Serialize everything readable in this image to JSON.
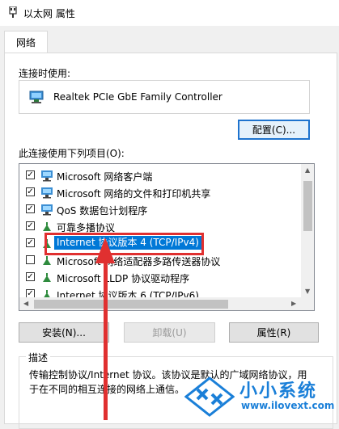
{
  "window": {
    "title": "以太网 属性"
  },
  "tabs": [
    {
      "label": "网络"
    }
  ],
  "connect_using": {
    "label": "连接时使用:",
    "adapter": "Realtek PCIe GbE Family Controller",
    "configure_button": "配置(C)..."
  },
  "items_section": {
    "label": "此连接使用下列项目(O):",
    "items": [
      {
        "label": "Microsoft 网络客户端",
        "checked": true,
        "icon": "network-client-icon"
      },
      {
        "label": "Microsoft 网络的文件和打印机共享",
        "checked": true,
        "icon": "file-printer-share-icon"
      },
      {
        "label": "QoS 数据包计划程序",
        "checked": true,
        "icon": "qos-icon"
      },
      {
        "label": "可靠多播协议",
        "checked": true,
        "icon": "protocol-icon"
      },
      {
        "label": "Internet 协议版本 4 (TCP/IPv4)",
        "checked": true,
        "icon": "protocol-icon",
        "selected": true
      },
      {
        "label": "Microsoft 网络适配器多路传送器协议",
        "checked": false,
        "icon": "protocol-icon"
      },
      {
        "label": "Microsoft LLDP 协议驱动程序",
        "checked": true,
        "icon": "protocol-icon"
      },
      {
        "label": "Internet 协议版本 6 (TCP/IPv6)",
        "checked": true,
        "icon": "protocol-icon"
      }
    ]
  },
  "buttons": {
    "install": "安装(N)...",
    "uninstall": "卸载(U)",
    "properties": "属性(R)"
  },
  "description": {
    "legend": "描述",
    "text": "传输控制协议/Internet 协议。该协议是默认的广域网络协议，用于在不同的相互连接的网络上通信。"
  },
  "watermark": {
    "brand": "小小系统",
    "url": "www.ilovext.com"
  },
  "colors": {
    "accent": "#0078d7",
    "annotation": "#e03030",
    "watermark": "#1a7fd8"
  }
}
